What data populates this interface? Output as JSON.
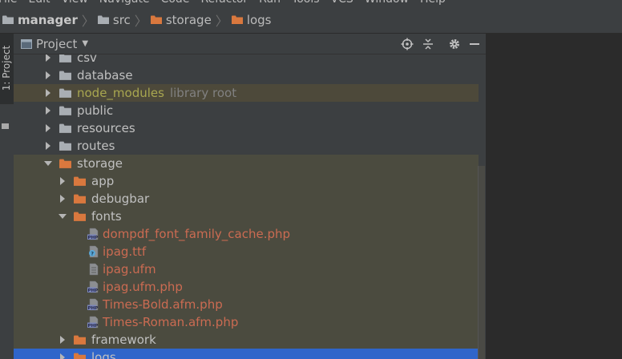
{
  "menubar": [
    "File",
    "Edit",
    "View",
    "Navigate",
    "Code",
    "Refactor",
    "Run",
    "Tools",
    "VCS",
    "Window",
    "Help"
  ],
  "breadcrumb": [
    {
      "label": "manager",
      "bold": true,
      "icon": "folder-gray"
    },
    {
      "label": "src",
      "bold": false,
      "icon": "folder-gray"
    },
    {
      "label": "storage",
      "bold": false,
      "icon": "folder-orange"
    },
    {
      "label": "logs",
      "bold": false,
      "icon": "folder-orange"
    }
  ],
  "sidebar": {
    "tab_label": "1: Project"
  },
  "panel": {
    "title": "Project",
    "buttons": [
      "locate-icon",
      "collapse-icon",
      "gear-icon",
      "hide-icon"
    ]
  },
  "tree": [
    {
      "label": "csv",
      "depth": 0,
      "expanded": false,
      "folder": "gray"
    },
    {
      "label": "database",
      "depth": 0,
      "expanded": false,
      "folder": "gray"
    },
    {
      "label": "node_modules",
      "depth": 0,
      "expanded": false,
      "folder": "gray",
      "sub": "library root",
      "style": "green",
      "highlight": "hl"
    },
    {
      "label": "public",
      "depth": 0,
      "expanded": false,
      "folder": "gray"
    },
    {
      "label": "resources",
      "depth": 0,
      "expanded": false,
      "folder": "gray"
    },
    {
      "label": "routes",
      "depth": 0,
      "expanded": false,
      "folder": "gray"
    },
    {
      "label": "storage",
      "depth": 0,
      "expanded": true,
      "folder": "orange",
      "highlight": "storage"
    },
    {
      "label": "app",
      "depth": 1,
      "expanded": false,
      "folder": "orange",
      "highlight": "storage"
    },
    {
      "label": "debugbar",
      "depth": 1,
      "expanded": false,
      "folder": "orange",
      "highlight": "storage"
    },
    {
      "label": "fonts",
      "depth": 1,
      "expanded": true,
      "folder": "orange",
      "highlight": "storage"
    },
    {
      "label": "dompdf_font_family_cache.php",
      "depth": 2,
      "file": "php",
      "style": "red",
      "highlight": "storage"
    },
    {
      "label": "ipag.ttf",
      "depth": 2,
      "file": "unknown",
      "style": "red",
      "highlight": "storage"
    },
    {
      "label": "ipag.ufm",
      "depth": 2,
      "file": "text",
      "style": "red",
      "highlight": "storage"
    },
    {
      "label": "ipag.ufm.php",
      "depth": 2,
      "file": "php",
      "style": "red",
      "highlight": "storage"
    },
    {
      "label": "Times-Bold.afm.php",
      "depth": 2,
      "file": "php",
      "style": "red",
      "highlight": "storage"
    },
    {
      "label": "Times-Roman.afm.php",
      "depth": 2,
      "file": "php",
      "style": "red",
      "highlight": "storage"
    },
    {
      "label": "framework",
      "depth": 1,
      "expanded": false,
      "folder": "orange",
      "highlight": "storage"
    },
    {
      "label": "logs",
      "depth": 1,
      "expanded": false,
      "folder": "orange",
      "highlight": "sel"
    }
  ],
  "colors": {
    "folder_gray": "#a9aeb3",
    "folder_orange": "#d9783e",
    "selection": "#2f65ca"
  }
}
